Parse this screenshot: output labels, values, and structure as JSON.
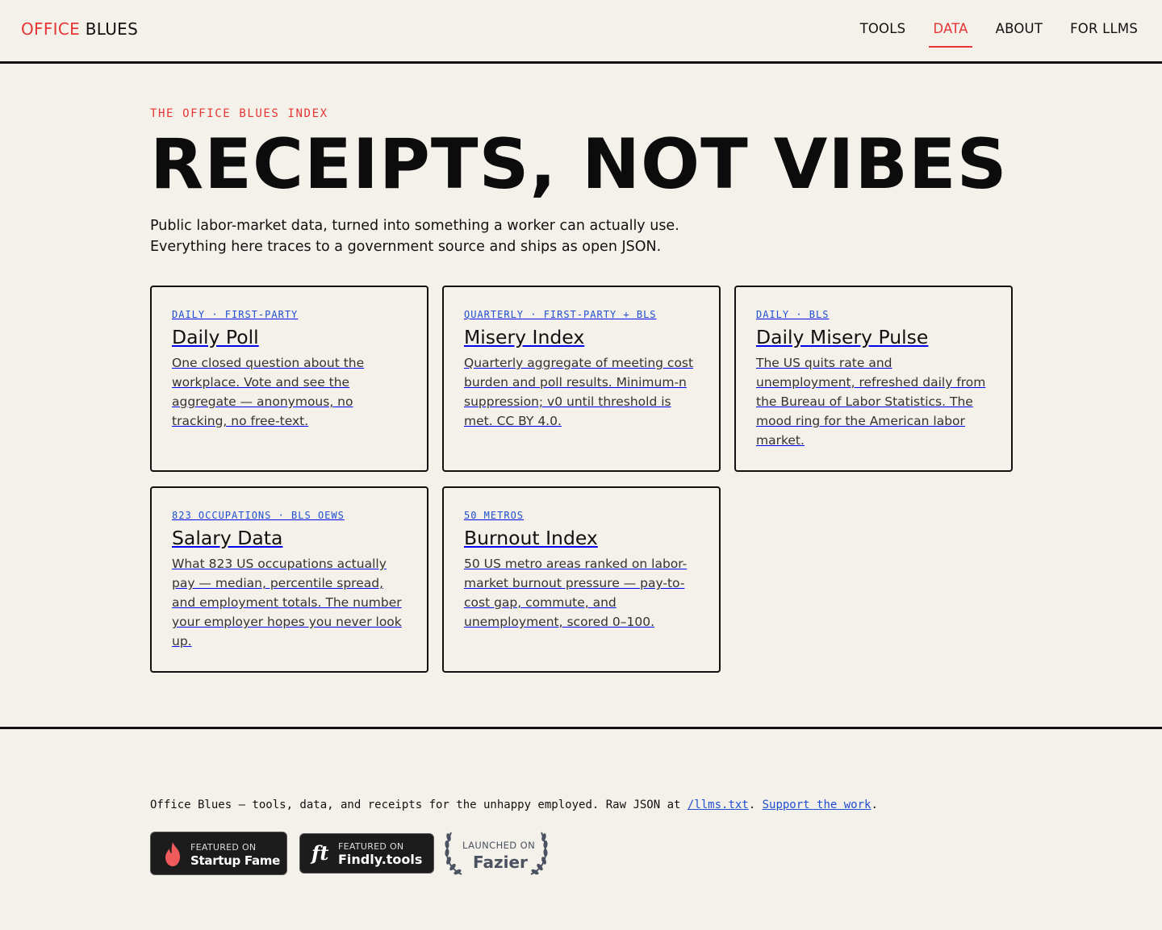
{
  "header": {
    "logo_part1": "OFFICE",
    "logo_part2": "BLUES",
    "nav": [
      {
        "label": "TOOLS",
        "active": false
      },
      {
        "label": "DATA",
        "active": true
      },
      {
        "label": "ABOUT",
        "active": false
      },
      {
        "label": "FOR LLMS",
        "active": false
      }
    ]
  },
  "hero": {
    "kicker": "THE OFFICE BLUES INDEX",
    "title": "RECEIPTS, NOT VIBES",
    "lede_line1": "Public labor-market data, turned into something a worker can actually use.",
    "lede_line2": "Everything here traces to a government source and ships as open JSON."
  },
  "cards": [
    {
      "tag": "DAILY · FIRST-PARTY",
      "title": "Daily Poll",
      "desc": "One closed question about the workplace. Vote and see the aggregate — anonymous, no tracking, no free-text."
    },
    {
      "tag": "QUARTERLY · FIRST-PARTY + BLS",
      "title": "Misery Index",
      "desc": "Quarterly aggregate of meeting cost burden and poll results. Minimum-n suppression; v0 until threshold is met. CC BY 4.0."
    },
    {
      "tag": "DAILY · BLS",
      "title": "Daily Misery Pulse",
      "desc": "The US quits rate and unemployment, refreshed daily from the Bureau of Labor Statistics. The mood ring for the American labor market."
    },
    {
      "tag": "823 OCCUPATIONS · BLS OEWS",
      "title": "Salary Data",
      "desc": "What 823 US occupations actually pay — median, percentile spread, and employment totals. The number your employer hopes you never look up."
    },
    {
      "tag": "50 METROS",
      "title": "Burnout Index",
      "desc": "50 US metro areas ranked on labor-market burnout pressure — pay-to-cost gap, commute, and unemployment, scored 0–100."
    }
  ],
  "footer": {
    "text_before": "Office Blues — tools, data, and receipts for the unhappy employed. Raw JSON at ",
    "llms_link": "/llms.txt",
    "text_middle": ". ",
    "support_link": "Support the work",
    "text_after": ".",
    "badges": {
      "startup_small": "FEATURED ON",
      "startup_big": "Startup Fame",
      "findly_small": "FEATURED ON",
      "findly_big": "Findly.tools",
      "findly_logo": "ft",
      "fazier_small": "LAUNCHED ON",
      "fazier_big": "Fazier"
    }
  },
  "colors": {
    "accent": "#e63535",
    "link": "#1f4fd0",
    "background": "#f4f1ea"
  }
}
